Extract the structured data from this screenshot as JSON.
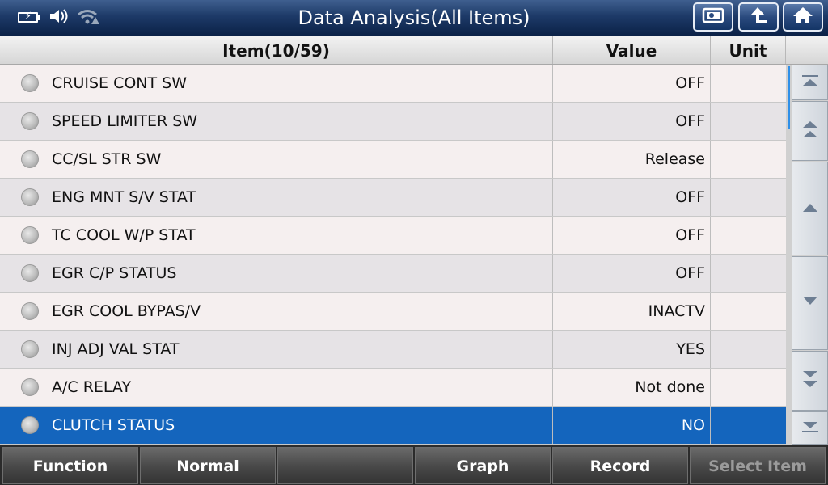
{
  "header": {
    "title": "Data Analysis(All Items)",
    "status_icons": [
      "battery-charging-icon",
      "speaker-icon",
      "wifi-warning-icon"
    ],
    "buttons": [
      "screenshot-icon",
      "back-arrow-icon",
      "home-icon"
    ]
  },
  "table": {
    "columns": {
      "item": "Item(10/59)",
      "value": "Value",
      "unit": "Unit"
    },
    "rows": [
      {
        "name": "CRUISE CONT SW",
        "value": "OFF",
        "unit": ""
      },
      {
        "name": "SPEED LIMITER SW",
        "value": "OFF",
        "unit": ""
      },
      {
        "name": "CC/SL STR SW",
        "value": "Release",
        "unit": ""
      },
      {
        "name": "ENG MNT S/V STAT",
        "value": "OFF",
        "unit": ""
      },
      {
        "name": "TC COOL W/P STAT",
        "value": "OFF",
        "unit": ""
      },
      {
        "name": "EGR C/P STATUS",
        "value": "OFF",
        "unit": ""
      },
      {
        "name": "EGR COOL BYPAS/V",
        "value": "INACTV",
        "unit": ""
      },
      {
        "name": "INJ ADJ VAL STAT",
        "value": "YES",
        "unit": ""
      },
      {
        "name": "A/C RELAY",
        "value": "Not done",
        "unit": ""
      },
      {
        "name": "CLUTCH STATUS",
        "value": "NO",
        "unit": "",
        "selected": true
      }
    ]
  },
  "scroll_buttons": [
    "scroll-top-icon",
    "page-up-icon",
    "line-up-icon",
    "line-down-icon",
    "page-down-icon",
    "scroll-bottom-icon"
  ],
  "footer": {
    "buttons": [
      {
        "label": "Function",
        "enabled": true
      },
      {
        "label": "Normal",
        "enabled": true
      },
      {
        "label": "",
        "enabled": true
      },
      {
        "label": "Graph",
        "enabled": true
      },
      {
        "label": "Record",
        "enabled": true
      },
      {
        "label": "Select Item",
        "enabled": false
      }
    ]
  },
  "colors": {
    "selected_row": "#1465bd",
    "topbar": "#1d3a68"
  }
}
